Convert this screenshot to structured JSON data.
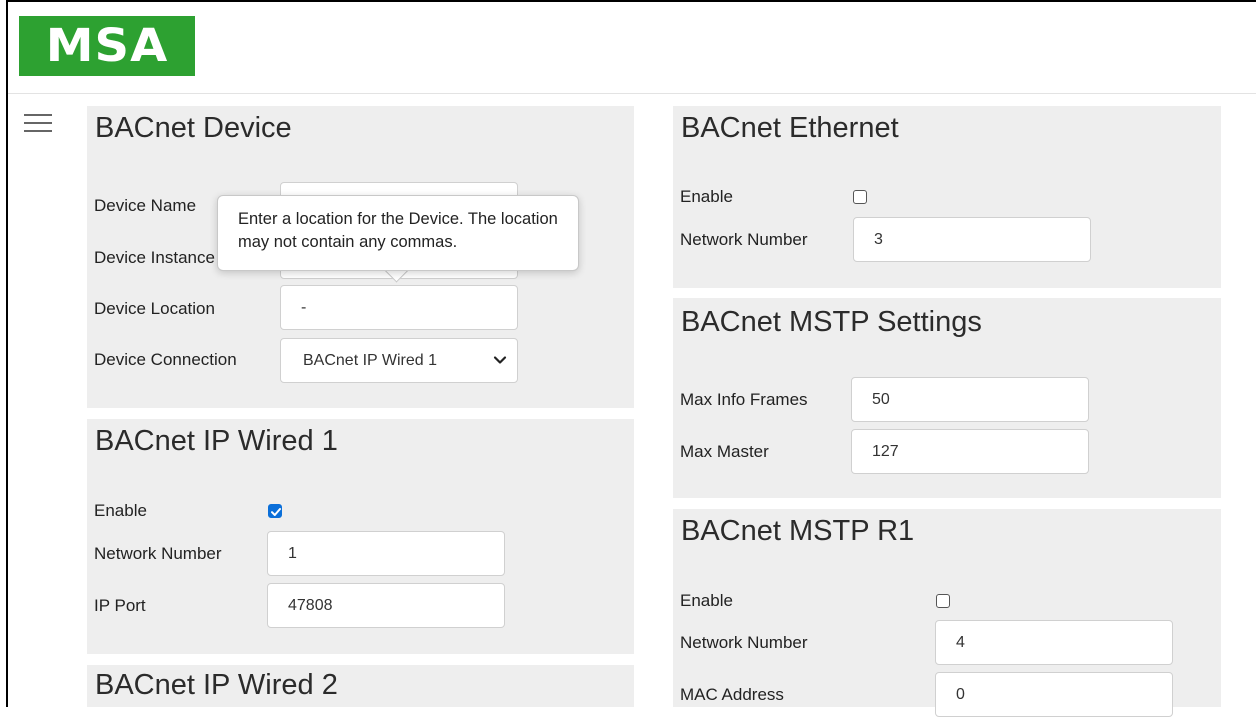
{
  "header": {
    "logo_text": "MSA",
    "logo_color": "#2da131"
  },
  "menu": {
    "icon": "hamburger-menu-icon"
  },
  "device": {
    "title": "BACnet Device",
    "name_label": "Device Name",
    "name_value": "",
    "instance_label": "Device Instance",
    "instance_value": "",
    "location_label": "Device Location",
    "location_value": "-",
    "connection_label": "Device Connection",
    "connection_value": "BACnet IP Wired 1"
  },
  "tooltip": {
    "text": "Enter a location for the Device. The location may not contain any commas."
  },
  "ip_wired_1": {
    "title": "BACnet IP Wired 1",
    "enable_label": "Enable",
    "enabled": true,
    "network_label": "Network Number",
    "network_value": "1",
    "port_label": "IP Port",
    "port_value": "47808"
  },
  "ip_wired_2": {
    "title": "BACnet IP Wired 2"
  },
  "ethernet": {
    "title": "BACnet Ethernet",
    "enable_label": "Enable",
    "enabled": false,
    "network_label": "Network Number",
    "network_value": "3"
  },
  "mstp_settings": {
    "title": "BACnet MSTP Settings",
    "max_info_label": "Max Info Frames",
    "max_info_value": "50",
    "max_master_label": "Max Master",
    "max_master_value": "127"
  },
  "mstp_r1": {
    "title": "BACnet MSTP R1",
    "enable_label": "Enable",
    "enabled": false,
    "network_label": "Network Number",
    "network_value": "4",
    "mac_label": "MAC Address",
    "mac_value": "0"
  },
  "accent_color": "#0b6fd9"
}
